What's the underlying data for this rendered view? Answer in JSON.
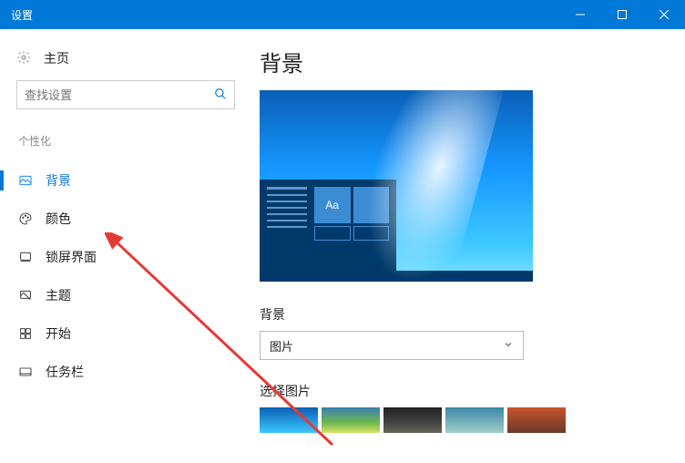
{
  "window": {
    "title": "设置"
  },
  "home_label": "主页",
  "search": {
    "placeholder": "查找设置"
  },
  "sidebar": {
    "section": "个性化",
    "items": [
      {
        "label": "背景"
      },
      {
        "label": "颜色"
      },
      {
        "label": "锁屏界面"
      },
      {
        "label": "主题"
      },
      {
        "label": "开始"
      },
      {
        "label": "任务栏"
      }
    ]
  },
  "main": {
    "heading": "背景",
    "preview_tile_text": "Aa",
    "bg_label": "背景",
    "dropdown_value": "图片",
    "choose_label": "选择图片"
  }
}
